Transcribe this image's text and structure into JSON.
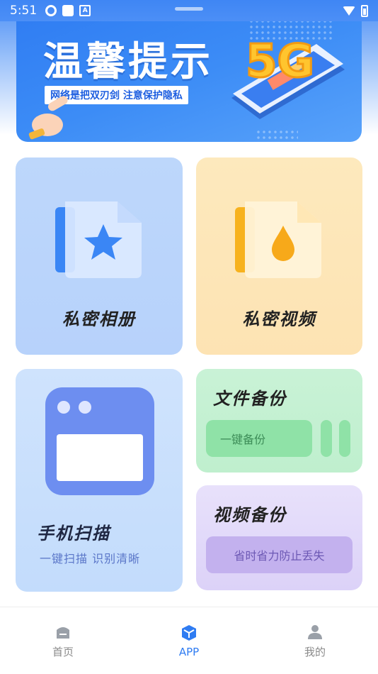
{
  "status_bar": {
    "time": "5:51"
  },
  "banner": {
    "title": "温馨提示",
    "subtitle": "网络是把双刃剑 注意保护隐私",
    "badge": "5G"
  },
  "cards": {
    "album": {
      "label": "私密相册"
    },
    "video": {
      "label": "私密视频"
    },
    "scan": {
      "title": "手机扫描",
      "subtitle": "一键扫描  识别清晰"
    },
    "file_backup": {
      "title": "文件备份",
      "button_label": "一键备份"
    },
    "video_backup": {
      "title": "视频备份",
      "button_label": "省时省力防止丢失"
    }
  },
  "bottom_nav": {
    "items": [
      {
        "label": "首页",
        "icon": "home-icon",
        "active": false
      },
      {
        "label": "APP",
        "icon": "cube-icon",
        "active": true
      },
      {
        "label": "我的",
        "icon": "user-icon",
        "active": false
      }
    ]
  },
  "colors": {
    "primary": "#2f7cf2",
    "album_bg": "#bdd7fb",
    "video_bg": "#fde9bd",
    "scan_bg": "#cfe3fd",
    "file_bg": "#c9f2d6",
    "vbak_bg": "#e8e1fb"
  }
}
